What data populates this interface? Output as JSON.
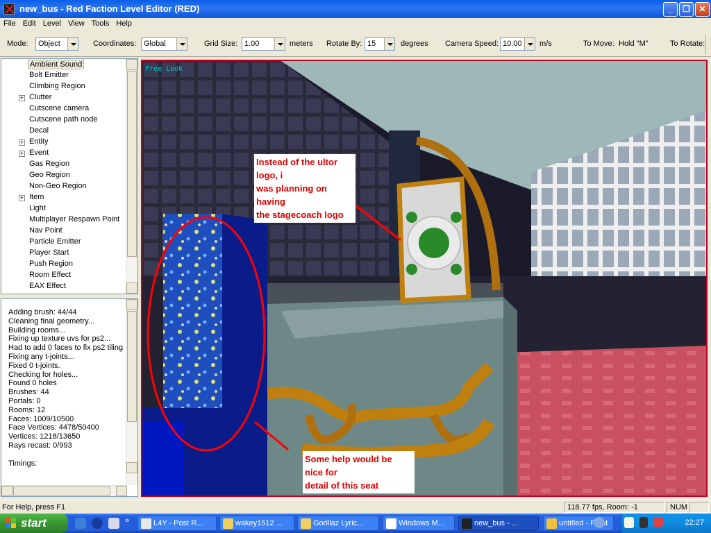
{
  "window": {
    "title": "new_bus - Red Faction Level Editor (RED)"
  },
  "menu": [
    "File",
    "Edit",
    "Level",
    "View",
    "Tools",
    "Help"
  ],
  "toolbar": {
    "mode_label": "Mode:",
    "mode_value": "Object",
    "coords_label": "Coordinates:",
    "coords_value": "Global",
    "grid_label": "Grid Size:",
    "grid_value": "1.00",
    "grid_unit": "meters",
    "rotate_label": "Rotate By:",
    "rotate_value": "15",
    "rotate_unit": "degrees",
    "camspeed_label": "Camera Speed:",
    "camspeed_value": "10.00",
    "camspeed_unit": "m/s",
    "tomove_label": "To Move:",
    "tomove_value": "Hold \"M\"",
    "torotate_label": "To Rotate:"
  },
  "tree": {
    "items": [
      {
        "label": "Ambient Sound",
        "expandable": false
      },
      {
        "label": "Bolt Emitter",
        "expandable": false
      },
      {
        "label": "Climbing Region",
        "expandable": false
      },
      {
        "label": "Clutter",
        "expandable": true
      },
      {
        "label": "Cutscene camera",
        "expandable": false
      },
      {
        "label": "Cutscene path node",
        "expandable": false
      },
      {
        "label": "Decal",
        "expandable": false
      },
      {
        "label": "Entity",
        "expandable": true
      },
      {
        "label": "Event",
        "expandable": true
      },
      {
        "label": "Gas Region",
        "expandable": false
      },
      {
        "label": "Geo Region",
        "expandable": false
      },
      {
        "label": "Non-Geo Region",
        "expandable": false
      },
      {
        "label": "Item",
        "expandable": true
      },
      {
        "label": "Light",
        "expandable": false
      },
      {
        "label": "Multiplayer Respawn Point",
        "expandable": false
      },
      {
        "label": "Nav Point",
        "expandable": false
      },
      {
        "label": "Particle Emitter",
        "expandable": false
      },
      {
        "label": "Player Start",
        "expandable": false
      },
      {
        "label": "Push Region",
        "expandable": false
      },
      {
        "label": "Room Effect",
        "expandable": false
      },
      {
        "label": "EAX Effect",
        "expandable": false
      }
    ]
  },
  "log": {
    "lines": [
      "Adding brush: 44/44",
      "Cleaning final geometry...",
      "Building rooms...",
      "Fixing up texture uvs for ps2...",
      "Had to add 0 faces to fix ps2 tiling",
      "Fixing any t-joints...",
      "Fixed 0 t-joints.",
      "Checking for holes...",
      "Found 0 holes",
      "Brushes: 44",
      "Portals: 0",
      "Rooms: 12",
      "Faces: 1009/10500",
      "Face Vertices: 4478/50400",
      "Vertices: 1218/13650",
      "Rays recast: 0/993",
      "",
      "Timings:"
    ]
  },
  "viewport": {
    "view_label": "Free Look",
    "annotation_logo": [
      "Instead of the ultor logo, i",
      "was planning on having",
      "the stagecoach logo"
    ],
    "annotation_seat": [
      "Some help would be nice for",
      "detail of this seat"
    ]
  },
  "status": {
    "help": "For Help, press F1",
    "fps": "118.77 fps, Room: -1",
    "num": "NUM"
  },
  "taskbar": {
    "start": "start",
    "tasks": [
      {
        "label": "L4Y - Post R...",
        "color": "#e8e8e8"
      },
      {
        "label": "wakey1512 ...",
        "color": "#f0d060"
      },
      {
        "label": "Gorillaz Lyric...",
        "color": "#f0d060"
      },
      {
        "label": "Windows M...",
        "color": "#ffffff"
      },
      {
        "label": "new_bus - ...",
        "color": "#222222"
      },
      {
        "label": "untitled - Paint",
        "color": "#f0c040"
      }
    ],
    "clock": "22:27"
  },
  "colors": {
    "accent": "#c00020",
    "annotation_text": "#e00000",
    "freelook": "#00c8c8"
  }
}
